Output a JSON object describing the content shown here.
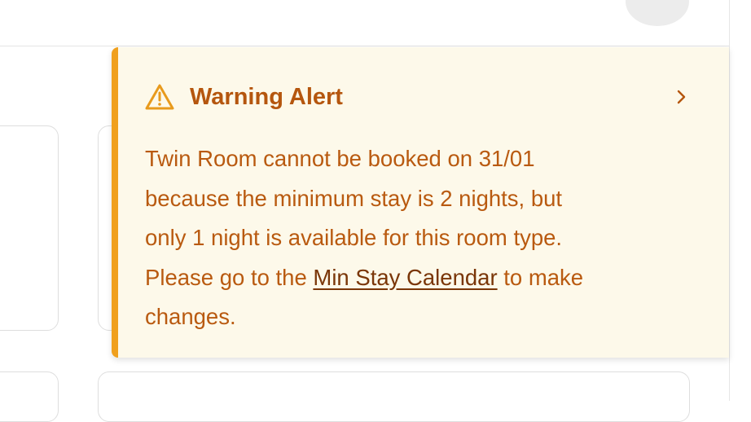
{
  "alert": {
    "title": "Warning Alert",
    "message": {
      "line1": "Twin Room cannot be booked on 31/01",
      "line2": "because the minimum stay is 2 nights, but",
      "line3": "only 1 night is available for this room type.",
      "line4_prefix": "Please go to the ",
      "link_text": "Min Stay Calendar",
      "line4_suffix": " to make",
      "line5": "changes."
    },
    "icon": "warning-triangle-icon",
    "expand_icon": "chevron-right-icon"
  },
  "colors": {
    "alert_background": "#fdf9ea",
    "alert_border": "#f0a01e",
    "alert_text": "#b95a10",
    "alert_link": "#7a3608"
  },
  "header": {
    "icons": [
      "download-icon",
      "settings-icon",
      "help-icon"
    ],
    "avatar": "user-avatar"
  }
}
